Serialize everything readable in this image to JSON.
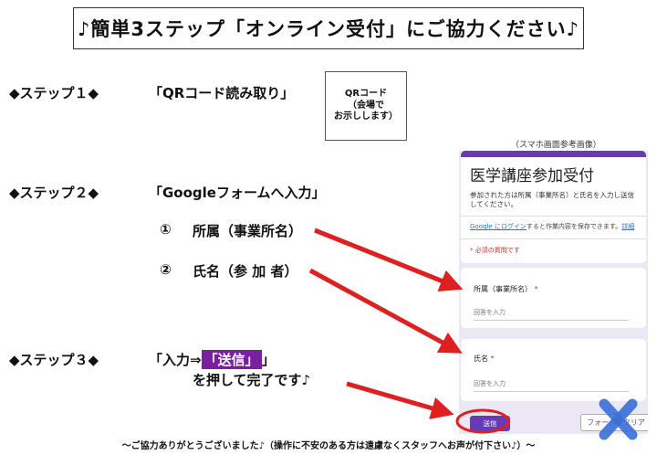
{
  "title": "♪簡単3ステップ「オンライン受付」にご協力ください♪",
  "steps": {
    "step1_label": "◆ステップ１◆",
    "step1_text": "「QRコード読み取り」",
    "step2_label": "◆ステップ２◆",
    "step2_text": "「Googleフォームへ入力」",
    "step2_item1_num": "①",
    "step2_item1_text": "所属（事業所名）",
    "step2_item2_num": "②",
    "step2_item2_text": "氏名（参 加 者）",
    "step3_label": "◆ステップ３◆",
    "step3_pre": "「入力⇒",
    "step3_badge": "「送信」",
    "step3_post": "」",
    "step3_line2": "を押して完了です♪"
  },
  "qr_box": {
    "line1": "QRコード",
    "line2": "（会場で",
    "line3": "お示しします）"
  },
  "phone": {
    "caption": "（スマホ画面参考画像）",
    "form_title": "医学講座参加受付",
    "form_desc": "参加された方は所属（事業所名）と氏名を入力し送信してください。",
    "login_link": "Google にログイン",
    "login_rest": "すると作業内容を保存できます。",
    "login_detail": "詳細",
    "required_note": "* 必須の質問です",
    "q1_label": "所属（事業所名）",
    "q1_placeholder": "回答を入力",
    "q2_label": "氏名",
    "q2_placeholder": "回答を入力",
    "required_star": "*",
    "submit_label": "送信",
    "clear_label": "フォームをクリア"
  },
  "footer": "～ご協力ありがとうございました♪（操作に不安のある方は遠慮なくスタッフへお声が付下さい♪）～",
  "colors": {
    "accent_purple": "#673ab7",
    "arrow_red": "#e02020",
    "cross_blue": "#3a6fd8"
  }
}
